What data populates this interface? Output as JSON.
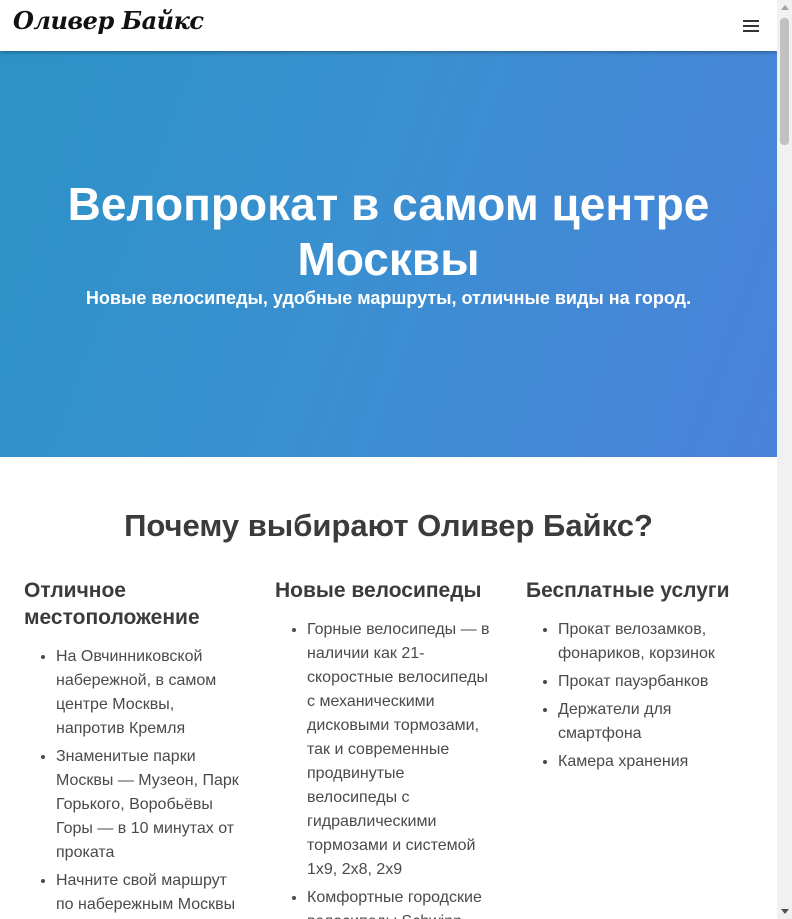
{
  "header": {
    "logo_text": "Оливер Байкс",
    "menu_icon": "hamburger-menu-icon"
  },
  "hero": {
    "title": "Велопрокат в самом центре Москвы",
    "subtitle": "Новые велосипеды, удобные маршруты, отличные виды на город."
  },
  "why": {
    "title": "Почему выбирают Оливер Байкс?",
    "columns": [
      {
        "heading": "Отличное местоположение",
        "items": [
          "На Овчинниковской набережной, в самом центре Москвы, напротив Кремля",
          "Знаменитые парки Москвы — Музеон, Парк Горького, Воробьёвы Горы — в 10 минутах от проката",
          "Начните свой маршрут по набережным Москвы"
        ]
      },
      {
        "heading": "Новые велосипеды",
        "items": [
          "Горные велосипеды — в наличии как 21-скоростные велосипеды с механическими дисковыми тормозами, так и современные продвинутые велосипеды с гидравлическими тормозами и системой 1x9, 2x8, 2x9",
          "Комфортные городские велосипеды Schwinn"
        ]
      },
      {
        "heading": "Бесплатные услуги",
        "items": [
          "Прокат велозамков, фонариков, корзинок",
          "Прокат пауэрбанков",
          "Держатели для смартфона",
          "Камера хранения"
        ]
      }
    ]
  }
}
